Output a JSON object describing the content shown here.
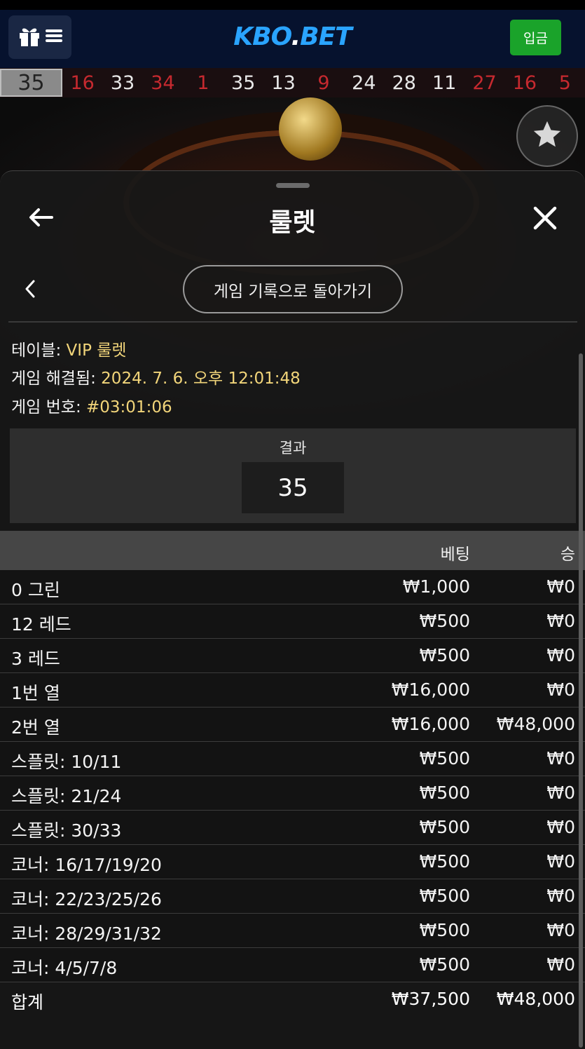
{
  "brand": {
    "logo_main": "KBO",
    "logo_dot": ".",
    "logo_tail": "BET"
  },
  "header": {
    "deposit_label": "입금"
  },
  "history": {
    "current": "35",
    "numbers": [
      {
        "value": "16",
        "color": "red"
      },
      {
        "value": "33",
        "color": "black"
      },
      {
        "value": "34",
        "color": "red"
      },
      {
        "value": "1",
        "color": "red"
      },
      {
        "value": "35",
        "color": "black"
      },
      {
        "value": "13",
        "color": "black"
      },
      {
        "value": "9",
        "color": "red"
      },
      {
        "value": "24",
        "color": "black"
      },
      {
        "value": "28",
        "color": "black"
      },
      {
        "value": "11",
        "color": "black"
      },
      {
        "value": "27",
        "color": "red"
      },
      {
        "value": "16",
        "color": "red"
      },
      {
        "value": "5",
        "color": "red"
      }
    ]
  },
  "panel": {
    "title": "룰렛",
    "return_label": "게임 기록으로 돌아가기"
  },
  "info": {
    "table_label": "테이블: ",
    "table_value": "VIP 룰렛",
    "resolved_label": "게임 해결됨: ",
    "resolved_value": "2024. 7. 6. 오후 12:01:48",
    "game_no_label": "게임 번호: ",
    "game_no_value": "#03:01:06"
  },
  "result": {
    "label": "결과",
    "value": "35"
  },
  "table": {
    "col_bet": "베팅",
    "col_win": "승",
    "rows": [
      {
        "name": "0 그린",
        "bet": "₩1,000",
        "win": "₩0"
      },
      {
        "name": "12 레드",
        "bet": "₩500",
        "win": "₩0"
      },
      {
        "name": "3 레드",
        "bet": "₩500",
        "win": "₩0"
      },
      {
        "name": "1번 열",
        "bet": "₩16,000",
        "win": "₩0"
      },
      {
        "name": "2번 열",
        "bet": "₩16,000",
        "win": "₩48,000"
      },
      {
        "name": "스플릿: 10/11",
        "bet": "₩500",
        "win": "₩0"
      },
      {
        "name": "스플릿: 21/24",
        "bet": "₩500",
        "win": "₩0"
      },
      {
        "name": "스플릿: 30/33",
        "bet": "₩500",
        "win": "₩0"
      },
      {
        "name": "코너: 16/17/19/20",
        "bet": "₩500",
        "win": "₩0"
      },
      {
        "name": "코너: 22/23/25/26",
        "bet": "₩500",
        "win": "₩0"
      },
      {
        "name": "코너: 28/29/31/32",
        "bet": "₩500",
        "win": "₩0"
      },
      {
        "name": "코너: 4/5/7/8",
        "bet": "₩500",
        "win": "₩0"
      }
    ],
    "total": {
      "name": "합계",
      "bet": "₩37,500",
      "win": "₩48,000"
    }
  },
  "colors": {
    "accent_blue": "#2aa4ff",
    "deposit_green": "#1aa32a",
    "highlight_yellow": "#f2d57a",
    "roulette_red": "#c6292f"
  },
  "icons": [
    "gift-icon",
    "menu-icon",
    "star-icon",
    "arrow-left-icon",
    "close-icon",
    "chevron-left-icon"
  ]
}
